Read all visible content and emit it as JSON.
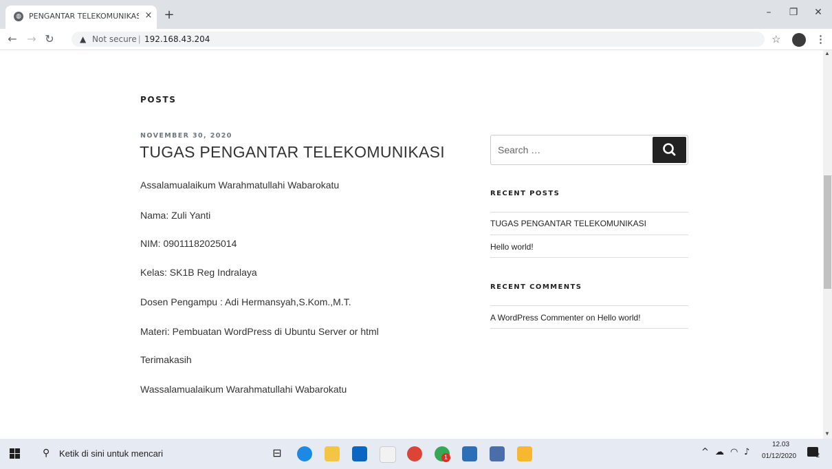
{
  "browser": {
    "tab_title": "PENGANTAR TELEKOMUNIKASI –",
    "tab_close": "×",
    "new_tab": "+",
    "security_label": "Not secure",
    "url": "192.168.43.204"
  },
  "page": {
    "posts_heading": "POSTS",
    "post_date": "NOVEMBER 30, 2020",
    "post_title": "TUGAS PENGANTAR TELEKOMUNIKASI",
    "paragraphs": [
      "Assalamualaikum Warahmatullahi Wabarokatu",
      "Nama: Zuli Yanti",
      "NIM: 09011182025014",
      "Kelas: SK1B Reg Indralaya",
      "Dosen Pengampu : Adi Hermansyah,S.Kom.,M.T.",
      "Materi: Pembuatan WordPress di Ubuntu Server or html",
      "Terimakasih",
      "Wassalamualaikum Warahmatullahi Wabarokatu"
    ]
  },
  "sidebar": {
    "search_placeholder": "Search …",
    "recent_posts_title": "RECENT POSTS",
    "recent_posts": [
      "TUGAS PENGANTAR TELEKOMUNIKASI",
      "Hello world!"
    ],
    "recent_comments_title": "RECENT COMMENTS",
    "recent_comment": "A WordPress Commenter on Hello world!"
  },
  "taskbar": {
    "search_text": "Ketik di sini untuk mencari",
    "time": "12.03",
    "date": "01/12/2020",
    "notification_count": "2",
    "chrome_badge": "1"
  }
}
